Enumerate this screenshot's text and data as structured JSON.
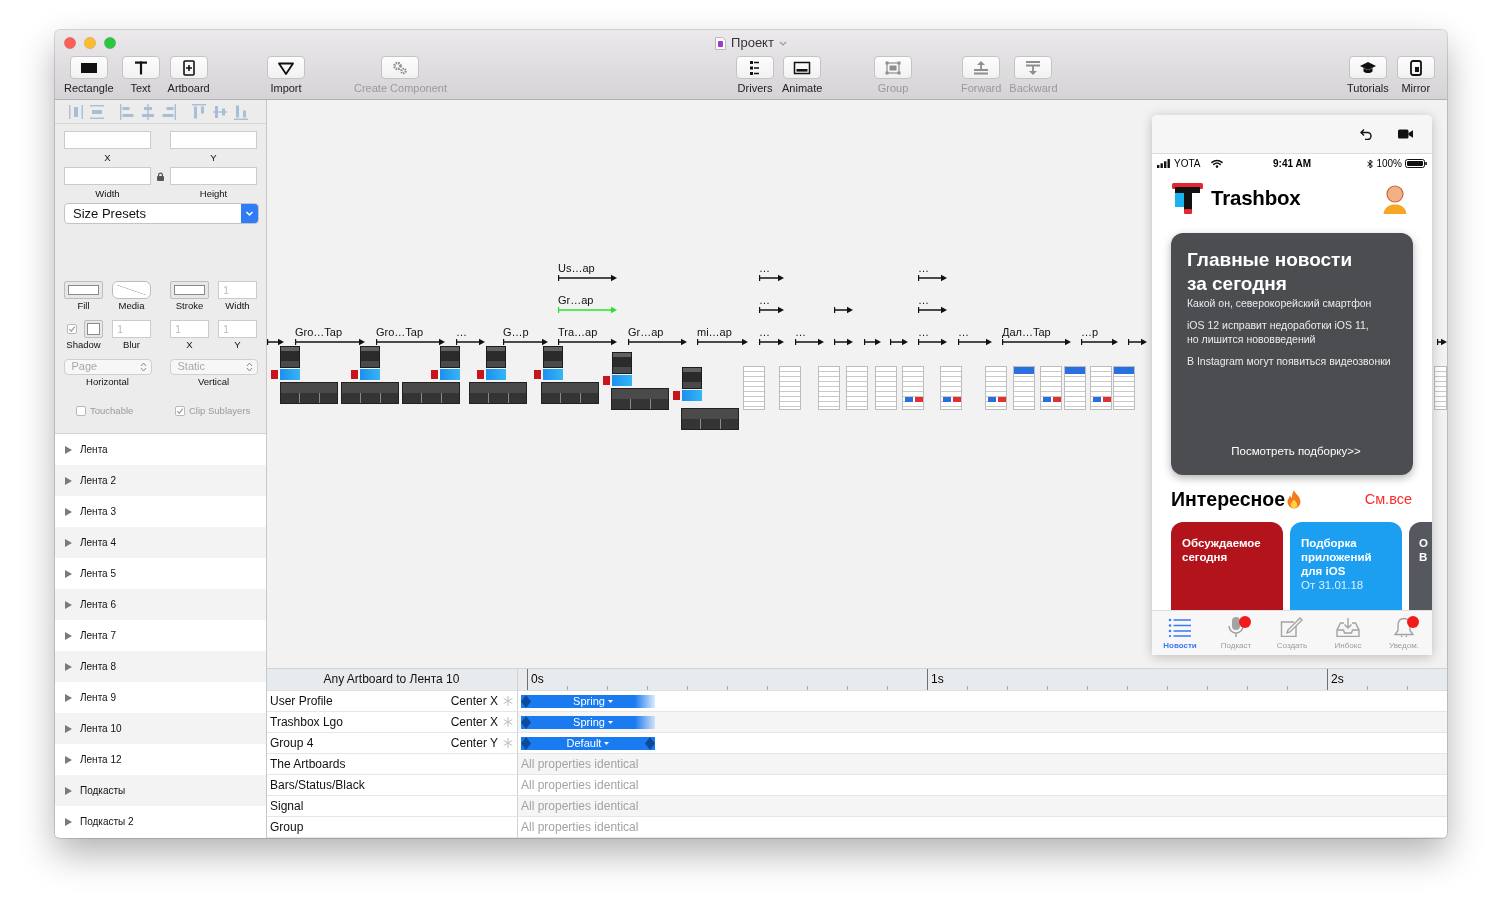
{
  "window": {
    "title": "Проект"
  },
  "toolbar": [
    {
      "items": [
        {
          "label": "Rectangle",
          "disabled": false
        },
        {
          "label": "Text",
          "disabled": false
        },
        {
          "label": "Artboard",
          "disabled": false
        }
      ]
    },
    {
      "items": [
        {
          "label": "Import",
          "disabled": false
        }
      ]
    },
    {
      "items": [
        {
          "label": "Create Component",
          "disabled": true
        }
      ]
    },
    {
      "items": [
        {
          "label": "Drivers",
          "disabled": false
        },
        {
          "label": "Animate",
          "disabled": false
        }
      ]
    },
    {
      "items": [
        {
          "label": "Group",
          "disabled": true
        }
      ]
    },
    {
      "items": [
        {
          "label": "Forward",
          "disabled": true
        },
        {
          "label": "Backward",
          "disabled": true
        }
      ]
    },
    {
      "items": [
        {
          "label": "Tutorials",
          "disabled": false
        },
        {
          "label": "Mirror",
          "disabled": false
        }
      ]
    }
  ],
  "inspector": {
    "frame_fields": [
      {
        "label": "X"
      },
      {
        "label": "Y"
      },
      {
        "label": "Width"
      },
      {
        "label": "Height"
      }
    ],
    "size_presets": "Size Presets",
    "appearance": [
      {
        "kind": "swatch",
        "label": "Fill"
      },
      {
        "kind": "media",
        "label": "Media"
      },
      {
        "kind": "swatch",
        "label": "Stroke"
      },
      {
        "kind": "number",
        "label": "Width",
        "placeholder": "1"
      },
      {
        "kind": "toggle-swatch",
        "label": "Shadow",
        "checked": true,
        "disabled": true
      },
      {
        "kind": "number",
        "label": "Blur",
        "placeholder": "1"
      },
      {
        "kind": "number",
        "label": "X",
        "placeholder": "1"
      },
      {
        "kind": "number",
        "label": "Y",
        "placeholder": "1"
      }
    ],
    "pinning": [
      {
        "label": "Horizontal",
        "value": "Page",
        "disabled": true
      },
      {
        "label": "Vertical",
        "value": "Static",
        "disabled": true
      }
    ],
    "options": [
      {
        "label": "Touchable",
        "checked": false,
        "disabled": true
      },
      {
        "label": "Clip Sublayers",
        "checked": true,
        "disabled": true
      }
    ]
  },
  "layers": [
    {
      "name": "Лента",
      "expanded": false
    },
    {
      "name": "Лента 2",
      "expanded": false
    },
    {
      "name": "Лента 3",
      "expanded": false
    },
    {
      "name": "Лента 4",
      "expanded": false
    },
    {
      "name": "Лента 5",
      "expanded": false
    },
    {
      "name": "Лента 6",
      "expanded": false
    },
    {
      "name": "Лента 7",
      "expanded": false
    },
    {
      "name": "Лента 8",
      "expanded": false
    },
    {
      "name": "Лента 9",
      "expanded": false
    },
    {
      "name": "Лента 10",
      "expanded": false
    },
    {
      "name": "Лента 12",
      "expanded": false
    },
    {
      "name": "Подкасты",
      "expanded": false
    },
    {
      "name": "Подкасты 2",
      "expanded": false
    }
  ],
  "canvas": {
    "connection_rows": [
      [
        {
          "label": "Us…ap",
          "highlighted": false
        },
        {
          "label": "…",
          "highlighted": false
        },
        {
          "label": "…",
          "highlighted": false
        }
      ],
      [
        {
          "label": "Gr…ap",
          "highlighted": true
        },
        {
          "label": "…",
          "highlighted": false
        },
        {
          "highlighted": false
        },
        {
          "label": "…",
          "highlighted": false
        }
      ],
      [
        {
          "highlighted": false
        },
        {
          "label": "Gro…Tap",
          "highlighted": false
        },
        {
          "label": "Gro…Tap",
          "highlighted": false
        },
        {
          "label": "…",
          "highlighted": false
        },
        {
          "label": "G…p",
          "highlighted": false
        },
        {
          "label": "Tra…ap",
          "highlighted": false
        },
        {
          "label": "Gr…ap",
          "highlighted": false
        },
        {
          "label": "mi…ap",
          "highlighted": false
        },
        {
          "label": "…",
          "highlighted": false
        },
        {
          "label": "…",
          "highlighted": false
        },
        {
          "highlighted": false
        },
        {
          "highlighted": false
        },
        {
          "highlighted": false
        },
        {
          "label": "…",
          "highlighted": false
        },
        {
          "label": "…",
          "highlighted": false
        },
        {
          "label": "Дал…Tap",
          "highlighted": false
        },
        {
          "label": "…p",
          "highlighted": false
        },
        {
          "highlighted": false
        },
        {
          "highlighted": false
        }
      ]
    ]
  },
  "preview": {
    "status_bar": {
      "carrier": "YOTA",
      "time": "9:41 AM",
      "battery": "100%"
    },
    "app_name": "Trashbox",
    "headline_card": {
      "title_lines": [
        "Главные новости",
        "за сегодня"
      ],
      "items": [
        [
          "Какой он, северокорейский смартфон"
        ],
        [
          "iOS 12 исправит недоработки iOS 11,",
          "но лишится нововведений"
        ],
        [
          "В Instagram могут появиться видеозвонки"
        ]
      ],
      "link": "Посмотреть подборку>>"
    },
    "section": {
      "title": "Интересное",
      "link": "См.все"
    },
    "cards": [
      {
        "title_lines": [
          "Обсуждаемое",
          "сегодня"
        ],
        "color": "#b3141c"
      },
      {
        "title_lines": [
          "Подборка",
          "приложений",
          "для iOS"
        ],
        "subtitle": "От 31.01.18",
        "color": "#1c9ff0"
      },
      {
        "title_lines": [
          "О",
          "В"
        ],
        "color": "#55595f"
      }
    ],
    "tabs": [
      {
        "label": "Новости",
        "selected": true,
        "badge": false
      },
      {
        "label": "Подкаст",
        "selected": false,
        "badge": true
      },
      {
        "label": "Создать",
        "selected": false,
        "badge": false
      },
      {
        "label": "Инбокс",
        "selected": false,
        "badge": false
      },
      {
        "label": "Уведом.",
        "selected": false,
        "badge": true
      }
    ]
  },
  "timeline": {
    "title": "Any Artboard to Лента 10",
    "ruler": [
      "0s",
      "1s",
      "2s"
    ],
    "rows": [
      {
        "layer": "User Profile",
        "kind": "animated",
        "property": "Center X",
        "curve": "Spring",
        "open_end": true
      },
      {
        "layer": "Trashbox Lgo",
        "kind": "animated",
        "property": "Center X",
        "curve": "Spring",
        "open_end": true
      },
      {
        "layer": "Group 4",
        "kind": "animated",
        "property": "Center Y",
        "curve": "Default",
        "open_end": false
      },
      {
        "layer": "The Artboards",
        "kind": "identical",
        "note": "All properties identical"
      },
      {
        "layer": "Bars/Status/Black",
        "kind": "identical",
        "note": "All properties identical"
      },
      {
        "layer": "Signal",
        "kind": "identical",
        "note": "All properties identical"
      },
      {
        "layer": "Group",
        "kind": "identical",
        "note": "All properties identical"
      }
    ]
  }
}
